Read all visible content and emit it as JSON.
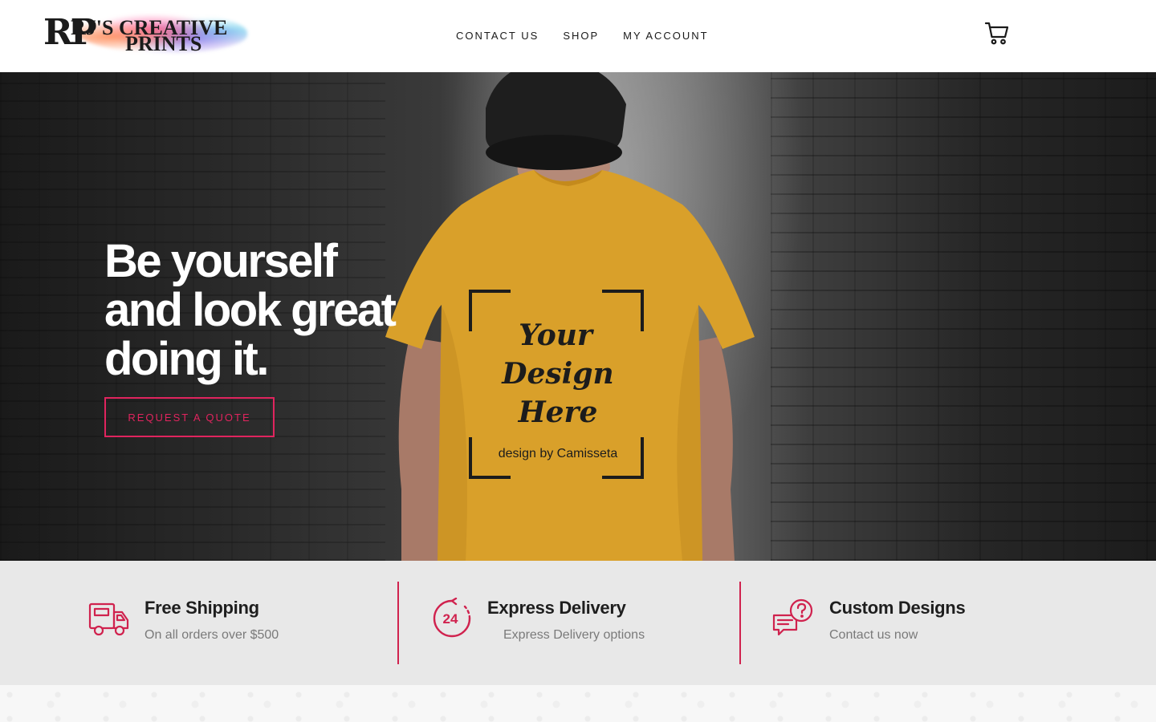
{
  "brand": {
    "logo_initials": "RP",
    "logo_line1": "RJ'S CREATIVE",
    "logo_line2": "PRINTS"
  },
  "nav": {
    "items": [
      {
        "label": "CONTACT US"
      },
      {
        "label": "SHOP"
      },
      {
        "label": "MY ACCOUNT"
      }
    ],
    "cart_icon": "cart-icon"
  },
  "hero": {
    "title_lines": [
      "Be yourself",
      "and look great",
      "doing it."
    ],
    "cta_label": "REQUEST A QUOTE",
    "shirt_text_lines": [
      "Your",
      "Design",
      "Here"
    ],
    "shirt_credit": "design by Camisseta"
  },
  "features": [
    {
      "icon": "truck-icon",
      "title": "Free Shipping",
      "subtitle": "On all orders over $500"
    },
    {
      "icon": "24h-delivery-icon",
      "title": "Express Delivery",
      "subtitle": "Express Delivery options"
    },
    {
      "icon": "chat-question-icon",
      "title": "Custom Designs",
      "subtitle": "Contact us now"
    }
  ],
  "colors": {
    "accent": "#e0245e",
    "feature_bg": "#e8e8e8",
    "shirt": "#d9a02a"
  }
}
